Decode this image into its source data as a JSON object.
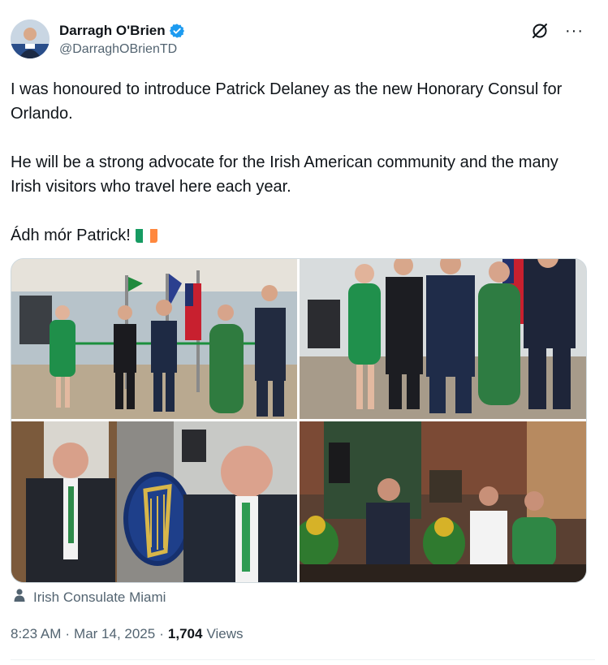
{
  "author": {
    "display_name": "Darragh O'Brien",
    "handle": "@DarraghOBrienTD",
    "verified_icon": "verified-badge-icon",
    "verified_color": "#1d9bf0"
  },
  "actions": {
    "grok_icon": "grok-icon",
    "more_icon": "more-icon",
    "more_label": "···"
  },
  "tweet": {
    "paragraph_1": "I was honoured to introduce Patrick Delaney as the new Honorary Consul for Orlando.",
    "paragraph_2": "He will be a strong advocate for the Irish American community and the many Irish visitors who travel here each year.",
    "paragraph_3": "Ádh mór Patrick!",
    "emoji": "ireland-flag-icon"
  },
  "media": [
    {
      "name": "ribbon-cutting-photo"
    },
    {
      "name": "group-photo"
    },
    {
      "name": "harp-emblem-photo"
    },
    {
      "name": "speech-photo"
    }
  ],
  "location": {
    "icon": "person-icon",
    "label": "Irish Consulate Miami"
  },
  "meta": {
    "time": "8:23 AM",
    "separator": "·",
    "date": "Mar 14, 2025",
    "views_count": "1,704",
    "views_label": "Views"
  },
  "colors": {
    "text": "#0f1419",
    "secondary": "#536471",
    "accent": "#1d9bf0"
  }
}
